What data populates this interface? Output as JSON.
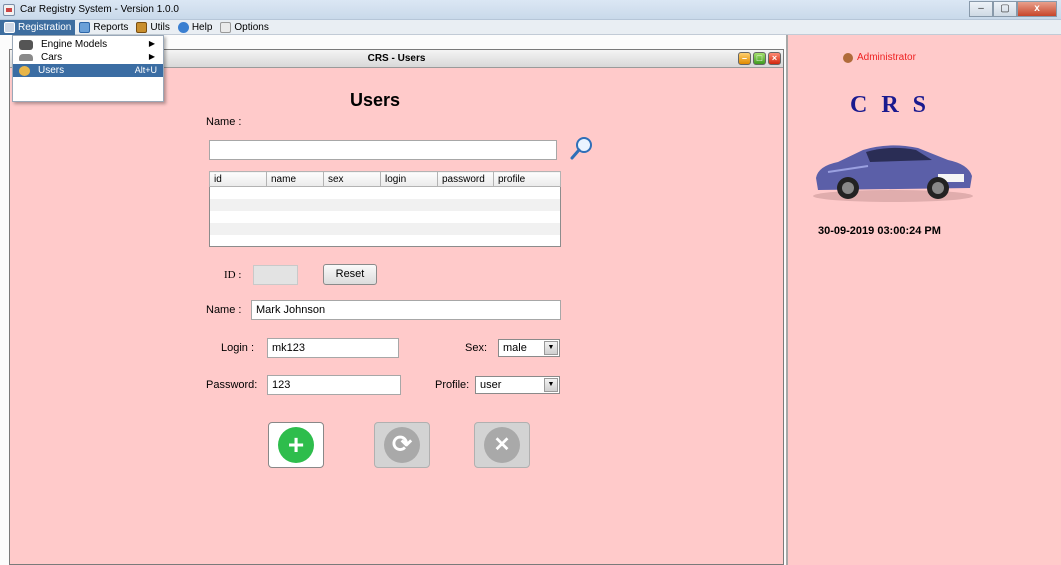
{
  "window": {
    "title": "Car Registry System  -  Version 1.0.0",
    "buttons": {
      "minimize": "–",
      "maximize": "▢",
      "close": "x"
    }
  },
  "menubar": {
    "items": [
      {
        "label": "Registration",
        "icon": "registration-icon",
        "active": true
      },
      {
        "label": "Reports",
        "icon": "reports-icon"
      },
      {
        "label": "Utils",
        "icon": "utils-icon"
      },
      {
        "label": "Help",
        "icon": "help-icon"
      },
      {
        "label": "Options",
        "icon": "options-icon"
      }
    ]
  },
  "registration_menu": {
    "items": [
      {
        "label": "Engine Models",
        "icon": "engine-icon",
        "submenu": "▶"
      },
      {
        "label": "Cars",
        "icon": "car-icon",
        "submenu": "▶"
      },
      {
        "label": "Users",
        "icon": "users-icon",
        "accelerator": "Alt+U",
        "selected": true
      }
    ]
  },
  "users_frame": {
    "title": "CRS - Users",
    "heading": "Users",
    "search": {
      "label": "Name :",
      "value": "",
      "icon": "magnifier-icon"
    },
    "table": {
      "columns": [
        "id",
        "name",
        "sex",
        "login",
        "password",
        "profile"
      ],
      "rows": [
        [
          "",
          "",
          "",
          "",
          "",
          ""
        ],
        [
          "",
          "",
          "",
          "",
          "",
          ""
        ],
        [
          "",
          "",
          "",
          "",
          "",
          ""
        ],
        [
          "",
          "",
          "",
          "",
          "",
          ""
        ],
        [
          "",
          "",
          "",
          "",
          "",
          ""
        ]
      ]
    },
    "form": {
      "id_label": "ID :",
      "id_value": "",
      "reset_label": "Reset",
      "name_label": "Name :",
      "name_value": "Mark Johnson",
      "login_label": "Login :",
      "login_value": "mk123",
      "sex_label": "Sex:",
      "sex_value": "male",
      "password_label": "Password:",
      "password_value": "123",
      "profile_label": "Profile:",
      "profile_value": "user"
    },
    "actions": {
      "add": {
        "icon": "plus-icon",
        "glyph": "+",
        "enabled": true
      },
      "update": {
        "icon": "refresh-icon",
        "glyph": "⟳",
        "enabled": false
      },
      "delete": {
        "icon": "cancel-icon",
        "glyph": "✕",
        "enabled": false
      }
    }
  },
  "right_panel": {
    "user": "Administrator",
    "logo": "C R S",
    "datetime": "30-09-2019 03:00:24 PM"
  },
  "colors": {
    "panel_bg": "#ffcaca",
    "menu_highlight": "#3b6da3",
    "admin_text": "#e22222",
    "logo_text": "#1a1a8f",
    "add_green": "#2ebd4c"
  }
}
